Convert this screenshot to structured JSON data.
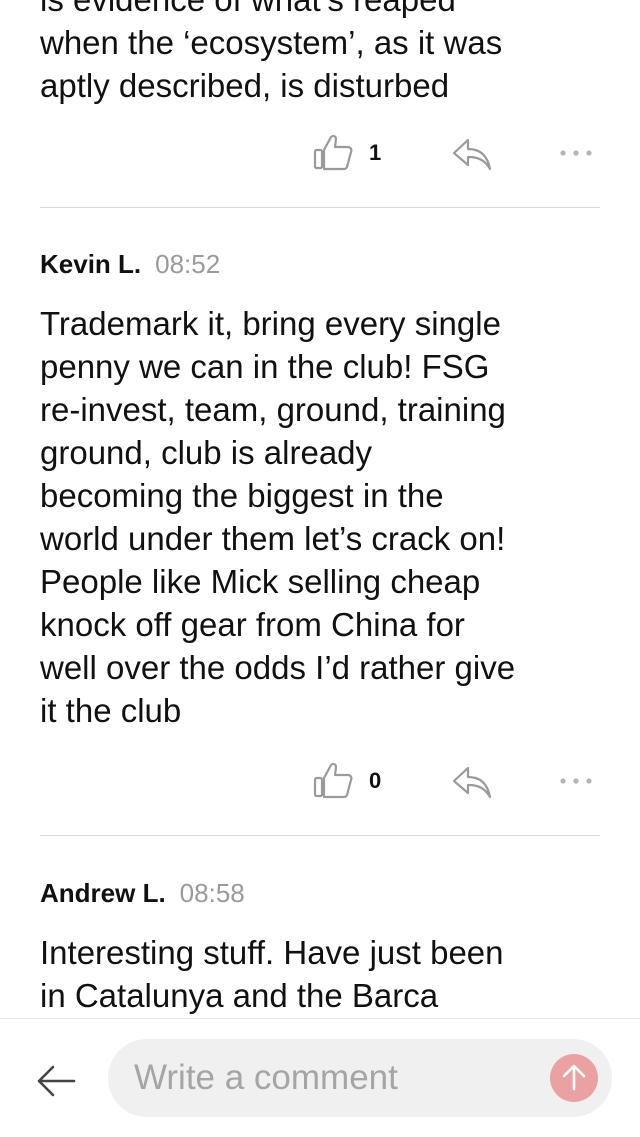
{
  "comments": [
    {
      "partial_lines": [
        "is evidence of what’s reaped",
        "when the ‘ecosystem’, as it was",
        "aptly described, is disturbed"
      ],
      "likes": "1"
    },
    {
      "author": "Kevin L.",
      "time": "08:52",
      "lines": [
        "Trademark it, bring every single",
        "penny we can in the club! FSG",
        "re-invest, team, ground, training",
        "ground, club is already",
        "becoming the biggest in the",
        "world under them let’s crack on!",
        "People like Mick selling cheap",
        "knock off gear from China for",
        "well over the odds I’d rather give",
        "it the club"
      ],
      "likes": "0"
    },
    {
      "author": "Andrew L.",
      "time": "08:58",
      "lines": [
        "Interesting stuff. Have just been",
        "in Catalunya and the Barca"
      ]
    }
  ],
  "composer": {
    "placeholder": "Write a comment"
  },
  "icons": {
    "like": "thumbs-up-icon",
    "reply": "reply-arrow-icon",
    "more": "more-dots-icon",
    "back": "back-arrow-icon",
    "send": "send-arrow-icon"
  },
  "colors": {
    "send_button": "#eba1a1",
    "timestamp": "#9a9a9a",
    "icon_gray": "#9a9a9a"
  }
}
